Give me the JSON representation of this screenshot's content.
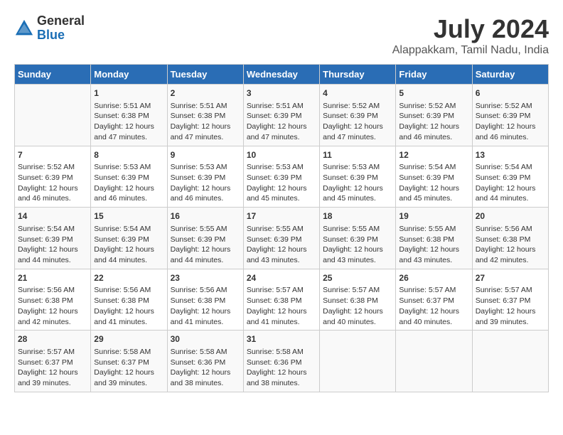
{
  "logo": {
    "general": "General",
    "blue": "Blue"
  },
  "title": "July 2024",
  "subtitle": "Alappakkam, Tamil Nadu, India",
  "days": [
    "Sunday",
    "Monday",
    "Tuesday",
    "Wednesday",
    "Thursday",
    "Friday",
    "Saturday"
  ],
  "weeks": [
    [
      {
        "day": "",
        "content": ""
      },
      {
        "day": "1",
        "content": "Sunrise: 5:51 AM\nSunset: 6:38 PM\nDaylight: 12 hours\nand 47 minutes."
      },
      {
        "day": "2",
        "content": "Sunrise: 5:51 AM\nSunset: 6:38 PM\nDaylight: 12 hours\nand 47 minutes."
      },
      {
        "day": "3",
        "content": "Sunrise: 5:51 AM\nSunset: 6:39 PM\nDaylight: 12 hours\nand 47 minutes."
      },
      {
        "day": "4",
        "content": "Sunrise: 5:52 AM\nSunset: 6:39 PM\nDaylight: 12 hours\nand 47 minutes."
      },
      {
        "day": "5",
        "content": "Sunrise: 5:52 AM\nSunset: 6:39 PM\nDaylight: 12 hours\nand 46 minutes."
      },
      {
        "day": "6",
        "content": "Sunrise: 5:52 AM\nSunset: 6:39 PM\nDaylight: 12 hours\nand 46 minutes."
      }
    ],
    [
      {
        "day": "7",
        "content": "Sunrise: 5:52 AM\nSunset: 6:39 PM\nDaylight: 12 hours\nand 46 minutes."
      },
      {
        "day": "8",
        "content": "Sunrise: 5:53 AM\nSunset: 6:39 PM\nDaylight: 12 hours\nand 46 minutes."
      },
      {
        "day": "9",
        "content": "Sunrise: 5:53 AM\nSunset: 6:39 PM\nDaylight: 12 hours\nand 46 minutes."
      },
      {
        "day": "10",
        "content": "Sunrise: 5:53 AM\nSunset: 6:39 PM\nDaylight: 12 hours\nand 45 minutes."
      },
      {
        "day": "11",
        "content": "Sunrise: 5:53 AM\nSunset: 6:39 PM\nDaylight: 12 hours\nand 45 minutes."
      },
      {
        "day": "12",
        "content": "Sunrise: 5:54 AM\nSunset: 6:39 PM\nDaylight: 12 hours\nand 45 minutes."
      },
      {
        "day": "13",
        "content": "Sunrise: 5:54 AM\nSunset: 6:39 PM\nDaylight: 12 hours\nand 44 minutes."
      }
    ],
    [
      {
        "day": "14",
        "content": "Sunrise: 5:54 AM\nSunset: 6:39 PM\nDaylight: 12 hours\nand 44 minutes."
      },
      {
        "day": "15",
        "content": "Sunrise: 5:54 AM\nSunset: 6:39 PM\nDaylight: 12 hours\nand 44 minutes."
      },
      {
        "day": "16",
        "content": "Sunrise: 5:55 AM\nSunset: 6:39 PM\nDaylight: 12 hours\nand 44 minutes."
      },
      {
        "day": "17",
        "content": "Sunrise: 5:55 AM\nSunset: 6:39 PM\nDaylight: 12 hours\nand 43 minutes."
      },
      {
        "day": "18",
        "content": "Sunrise: 5:55 AM\nSunset: 6:39 PM\nDaylight: 12 hours\nand 43 minutes."
      },
      {
        "day": "19",
        "content": "Sunrise: 5:55 AM\nSunset: 6:38 PM\nDaylight: 12 hours\nand 43 minutes."
      },
      {
        "day": "20",
        "content": "Sunrise: 5:56 AM\nSunset: 6:38 PM\nDaylight: 12 hours\nand 42 minutes."
      }
    ],
    [
      {
        "day": "21",
        "content": "Sunrise: 5:56 AM\nSunset: 6:38 PM\nDaylight: 12 hours\nand 42 minutes."
      },
      {
        "day": "22",
        "content": "Sunrise: 5:56 AM\nSunset: 6:38 PM\nDaylight: 12 hours\nand 41 minutes."
      },
      {
        "day": "23",
        "content": "Sunrise: 5:56 AM\nSunset: 6:38 PM\nDaylight: 12 hours\nand 41 minutes."
      },
      {
        "day": "24",
        "content": "Sunrise: 5:57 AM\nSunset: 6:38 PM\nDaylight: 12 hours\nand 41 minutes."
      },
      {
        "day": "25",
        "content": "Sunrise: 5:57 AM\nSunset: 6:38 PM\nDaylight: 12 hours\nand 40 minutes."
      },
      {
        "day": "26",
        "content": "Sunrise: 5:57 AM\nSunset: 6:37 PM\nDaylight: 12 hours\nand 40 minutes."
      },
      {
        "day": "27",
        "content": "Sunrise: 5:57 AM\nSunset: 6:37 PM\nDaylight: 12 hours\nand 39 minutes."
      }
    ],
    [
      {
        "day": "28",
        "content": "Sunrise: 5:57 AM\nSunset: 6:37 PM\nDaylight: 12 hours\nand 39 minutes."
      },
      {
        "day": "29",
        "content": "Sunrise: 5:58 AM\nSunset: 6:37 PM\nDaylight: 12 hours\nand 39 minutes."
      },
      {
        "day": "30",
        "content": "Sunrise: 5:58 AM\nSunset: 6:36 PM\nDaylight: 12 hours\nand 38 minutes."
      },
      {
        "day": "31",
        "content": "Sunrise: 5:58 AM\nSunset: 6:36 PM\nDaylight: 12 hours\nand 38 minutes."
      },
      {
        "day": "",
        "content": ""
      },
      {
        "day": "",
        "content": ""
      },
      {
        "day": "",
        "content": ""
      }
    ]
  ]
}
